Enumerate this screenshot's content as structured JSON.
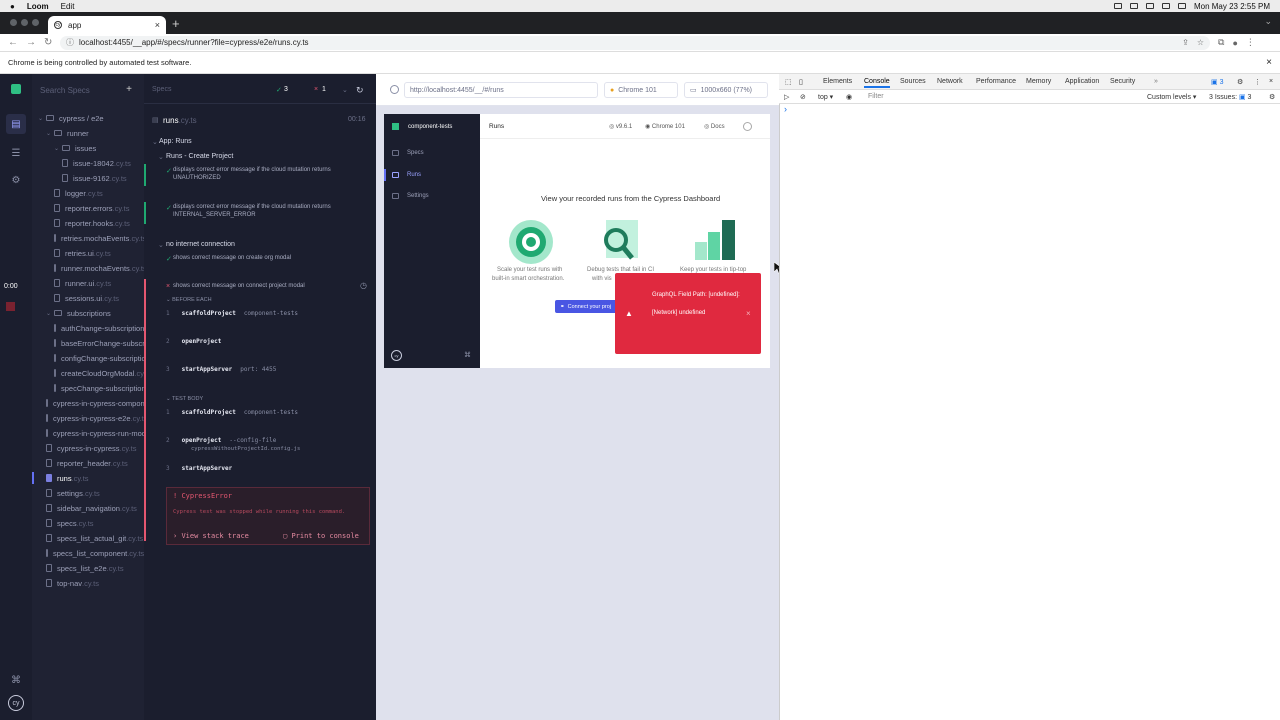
{
  "mac_menubar": {
    "app": "Loom",
    "menu": "Edit",
    "datetime": "Mon May 23  2:55 PM"
  },
  "browser": {
    "tab_title": "app",
    "url": "localhost:4455/__app/#/specs/runner?file=cypress/e2e/runs.cy.ts",
    "automation_notice": "Chrome is being controlled by automated test software."
  },
  "cypress_nav": {
    "timer": "0:00"
  },
  "spec_list": {
    "search_placeholder": "Search Specs",
    "items": [
      {
        "name": "cypress / e2e",
        "ext": "",
        "kind": "folder"
      },
      {
        "name": "runner",
        "ext": "",
        "kind": "folder"
      },
      {
        "name": "issues",
        "ext": "",
        "kind": "folder"
      },
      {
        "name": "issue-18042",
        "ext": ".cy.ts",
        "kind": "file"
      },
      {
        "name": "issue-9162",
        "ext": ".cy.ts",
        "kind": "file"
      },
      {
        "name": "logger",
        "ext": ".cy.ts",
        "kind": "file"
      },
      {
        "name": "reporter.errors",
        "ext": ".cy.ts",
        "kind": "file"
      },
      {
        "name": "reporter.hooks",
        "ext": ".cy.ts",
        "kind": "file"
      },
      {
        "name": "retries.mochaEvents",
        "ext": ".cy.ts",
        "kind": "file"
      },
      {
        "name": "retries.ui",
        "ext": ".cy.ts",
        "kind": "file"
      },
      {
        "name": "runner.mochaEvents",
        "ext": ".cy.ts",
        "kind": "file"
      },
      {
        "name": "runner.ui",
        "ext": ".cy.ts",
        "kind": "file"
      },
      {
        "name": "sessions.ui",
        "ext": ".cy.ts",
        "kind": "file"
      },
      {
        "name": "subscriptions",
        "ext": "",
        "kind": "folder"
      },
      {
        "name": "authChange-subscription",
        "ext": ".cy.ts",
        "kind": "file"
      },
      {
        "name": "baseErrorChange-subscription",
        "ext": ".cy.ts",
        "kind": "file"
      },
      {
        "name": "configChange-subscription",
        "ext": ".cy.ts",
        "kind": "file"
      },
      {
        "name": "createCloudOrgModal",
        "ext": ".cy.ts",
        "kind": "file"
      },
      {
        "name": "specChange-subscription",
        "ext": ".cy.ts",
        "kind": "file"
      },
      {
        "name": "cypress-in-cypress-component",
        "ext": ".cy.ts",
        "kind": "file"
      },
      {
        "name": "cypress-in-cypress-e2e",
        "ext": ".cy.ts",
        "kind": "file"
      },
      {
        "name": "cypress-in-cypress-run-mode",
        "ext": ".cy.ts",
        "kind": "file"
      },
      {
        "name": "cypress-in-cypress",
        "ext": ".cy.ts",
        "kind": "file"
      },
      {
        "name": "reporter_header",
        "ext": ".cy.ts",
        "kind": "file"
      },
      {
        "name": "runs",
        "ext": ".cy.ts",
        "kind": "file",
        "active": true
      },
      {
        "name": "settings",
        "ext": ".cy.ts",
        "kind": "file"
      },
      {
        "name": "sidebar_navigation",
        "ext": ".cy.ts",
        "kind": "file"
      },
      {
        "name": "specs",
        "ext": ".cy.ts",
        "kind": "file"
      },
      {
        "name": "specs_list_actual_git",
        "ext": ".cy.ts",
        "kind": "file"
      },
      {
        "name": "specs_list_component",
        "ext": ".cy.ts",
        "kind": "file"
      },
      {
        "name": "specs_list_e2e",
        "ext": ".cy.ts",
        "kind": "file"
      },
      {
        "name": "top-nav",
        "ext": ".cy.ts",
        "kind": "file"
      }
    ]
  },
  "reporter": {
    "specs_label": "Specs",
    "passed_count": "3",
    "failed_count": "1",
    "spec_name": "runs",
    "spec_ext": ".cy.ts",
    "duration": "00:16",
    "suite": "App: Runs",
    "sub_suite": "Runs - Create Project",
    "test1": "displays correct error message if the cloud mutation returns",
    "test1b": "UNAUTHORIZED",
    "test2": "displays correct error message if the cloud mutation returns",
    "test2b": "INTERNAL_SERVER_ERROR",
    "suite2": "no internet connection",
    "test3": "shows correct message on create org modal",
    "test4": "shows correct message on connect project modal",
    "before_each": "BEFORE EACH",
    "test_body": "TEST BODY",
    "commands_before": [
      {
        "num": "1",
        "cmd": "scaffoldProject",
        "arg": "component-tests"
      },
      {
        "num": "2",
        "cmd": "openProject",
        "arg": ""
      },
      {
        "num": "3",
        "cmd": "startAppServer",
        "arg": "port: 4455"
      }
    ],
    "commands_body": [
      {
        "num": "1",
        "cmd": "scaffoldProject",
        "arg": "component-tests"
      },
      {
        "num": "2",
        "cmd": "openProject",
        "arg": "--config-file"
      },
      {
        "num": "3",
        "cmd": "startAppServer",
        "arg": ""
      }
    ],
    "config_arg2": "cypressWithoutProjectId.config.js",
    "error_title": "CypressError",
    "error_msg": "Cypress test was stopped while running this command.",
    "view_stack": "View stack trace",
    "print_console": "Print to console"
  },
  "aut": {
    "url": "http://localhost:4455/__/#/runs",
    "browser": "Chrome 101",
    "viewport": "1000x660 (77%)"
  },
  "app_preview": {
    "project": "component-tests",
    "nav": [
      "Specs",
      "Runs",
      "Settings"
    ],
    "page_title": "Runs",
    "version": "v9.6.1",
    "browser": "Chrome 101",
    "docs": "Docs",
    "headline": "View your recorded runs from the Cypress Dashboard",
    "feature1a": "Scale your test runs with",
    "feature1b": "built-in smart orchestration.",
    "feature2a": "Debug tests that fail in CI",
    "feature2b": "with vis",
    "feature3a": "Keep your tests in tip-top",
    "connect_btn": "Connect your proj",
    "toast_title": "GraphQL Field Path: [undefined]:",
    "toast_msg": "[Network] undefined"
  },
  "devtools": {
    "tabs": [
      "Elements",
      "Console",
      "Sources",
      "Network",
      "Performance",
      "Memory",
      "Application",
      "Security"
    ],
    "active_tab": "Console",
    "issues_badge": "3",
    "context": "top",
    "filter_placeholder": "Filter",
    "levels": "Custom levels",
    "issues": "3 Issues:",
    "issues_count": "3",
    "prompt": "›"
  },
  "colors": {
    "cypress_dark": "#1b1e2e",
    "pass": "#1fa971",
    "fail": "#e45770",
    "toast": "#e0293f",
    "accent": "#6470f3"
  }
}
